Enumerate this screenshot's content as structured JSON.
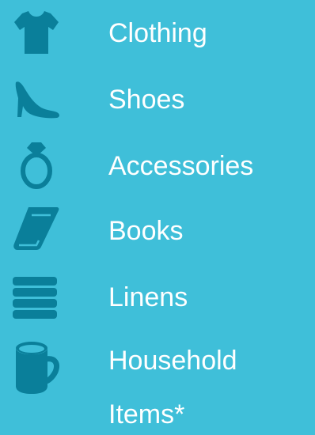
{
  "colors": {
    "background": "#3fbfd9",
    "icon": "#0a7f9a",
    "text": "#ffffff"
  },
  "menu": {
    "items": [
      {
        "label": "Clothing",
        "icon": "tshirt-icon"
      },
      {
        "label": "Shoes",
        "icon": "high-heel-shoe-icon"
      },
      {
        "label": "Accessories",
        "icon": "ring-icon"
      },
      {
        "label": "Books",
        "icon": "book-icon"
      },
      {
        "label": "Linens",
        "icon": "folded-linens-icon"
      },
      {
        "label": "Household",
        "label_line2": "Items*",
        "icon": "mug-icon"
      }
    ]
  }
}
